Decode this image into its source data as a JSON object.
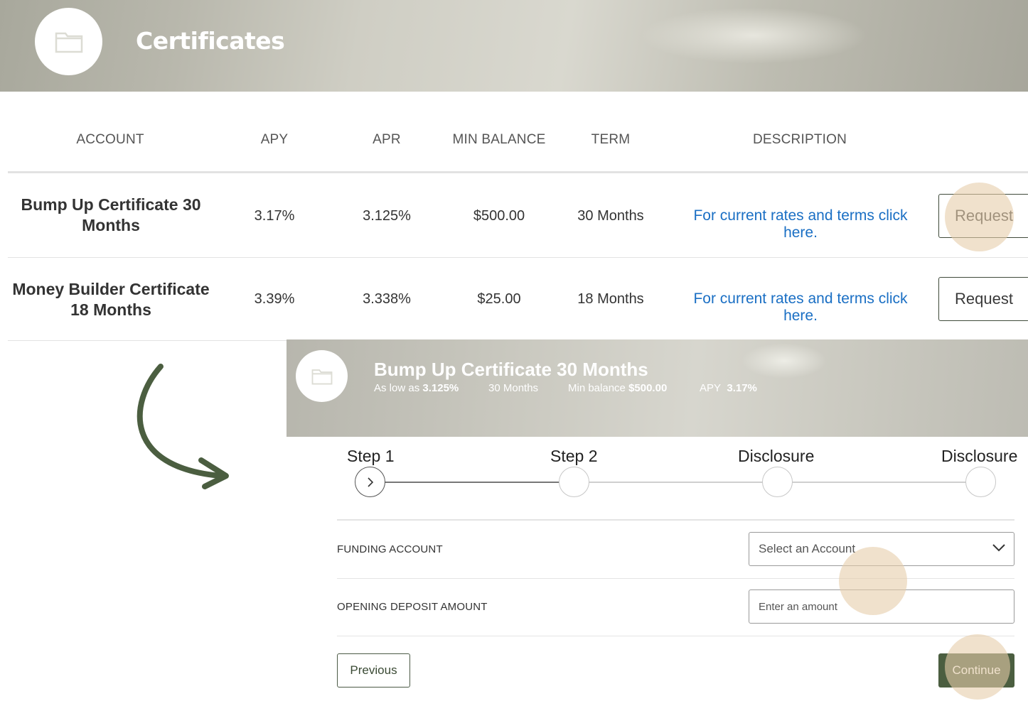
{
  "header": {
    "title": "Certificates",
    "icon": "folder-icon"
  },
  "table": {
    "columns": [
      "ACCOUNT",
      "APY",
      "APR",
      "MIN BALANCE",
      "TERM",
      "DESCRIPTION"
    ],
    "rows": [
      {
        "account_line1": "Bump Up Certificate 30",
        "account_line2": "Months",
        "apy": "3.17%",
        "apr": "3.125%",
        "min_balance": "$500.00",
        "term": "30 Months",
        "description": "For current rates and terms click here.",
        "action": "Request"
      },
      {
        "account_line1": "Money Builder Certificate",
        "account_line2": "18 Months",
        "apy": "3.39%",
        "apr": "3.338%",
        "min_balance": "$25.00",
        "term": "18 Months",
        "description": "For current rates and terms click here.",
        "action": "Request"
      }
    ]
  },
  "detail": {
    "title": "Bump Up Certificate 30 Months",
    "low_prefix": "As low as",
    "low_value": "3.125%",
    "term": "30 Months",
    "min_prefix": "Min balance",
    "min_value": "$500.00",
    "apy_prefix": "APY",
    "apy_value": "3.17%",
    "icon": "folder-icon"
  },
  "stepper": {
    "steps": [
      "Step 1",
      "Step 2",
      "Disclosure",
      "Disclosure"
    ],
    "active_index": 0
  },
  "form": {
    "funding_label": "FUNDING ACCOUNT",
    "funding_placeholder": "Select an Account",
    "deposit_label": "OPENING DEPOSIT AMOUNT",
    "deposit_placeholder": "Enter an amount",
    "previous": "Previous",
    "continue": "Continue"
  },
  "colors": {
    "accent_green": "#4b5e40",
    "link_blue": "#1a6fc4",
    "highlight": "#e6cdaa"
  }
}
